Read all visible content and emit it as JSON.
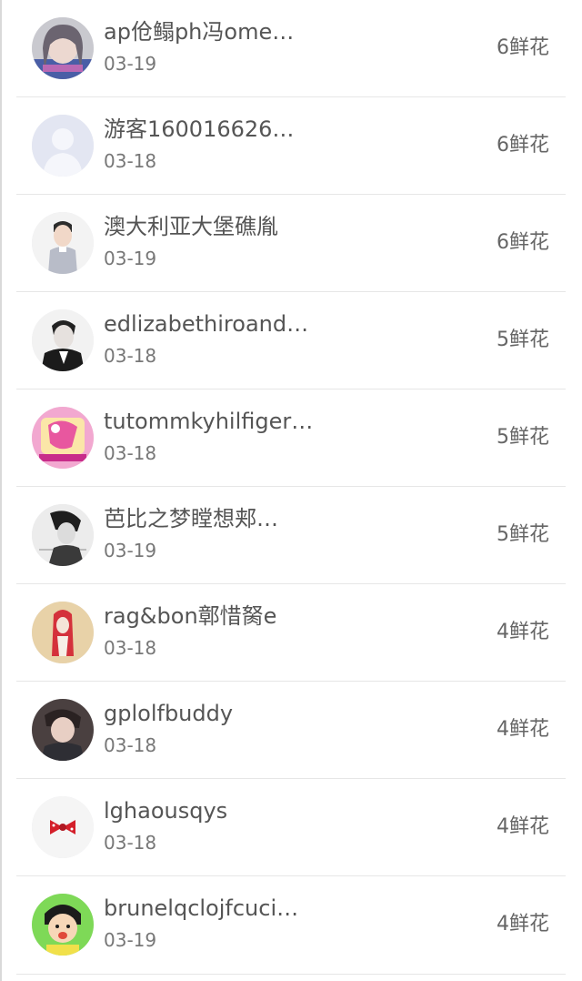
{
  "flower_ranking": {
    "rows": [
      {
        "name": "ap伧鳎ph冯ome…",
        "date": "03-19",
        "flowers": "6鲜花",
        "avatar_icon": "girl-photo-avatar-icon"
      },
      {
        "name": "游客160016626…",
        "date": "03-18",
        "flowers": "6鲜花",
        "avatar_icon": "default-user-avatar-icon"
      },
      {
        "name": "澳大利亚大堡礁胤",
        "date": "03-19",
        "flowers": "6鲜花",
        "avatar_icon": "boy-photo-avatar-icon"
      },
      {
        "name": "edlizabethiroand…",
        "date": "03-18",
        "flowers": "5鲜花",
        "avatar_icon": "man-bw-photo-avatar-icon"
      },
      {
        "name": "tutommkyhilfiger…",
        "date": "03-18",
        "flowers": "5鲜花",
        "avatar_icon": "pink-cartoon-avatar-icon"
      },
      {
        "name": "芭比之梦瞠想郏…",
        "date": "03-19",
        "flowers": "5鲜花",
        "avatar_icon": "sketch-portrait-avatar-icon"
      },
      {
        "name": "rag&bon鄣惜胬e",
        "date": "03-18",
        "flowers": "4鲜花",
        "avatar_icon": "red-hair-illustration-avatar-icon"
      },
      {
        "name": "gplolfbuddy",
        "date": "03-18",
        "flowers": "4鲜花",
        "avatar_icon": "young-man-photo-avatar-icon"
      },
      {
        "name": "lghaousqys",
        "date": "03-18",
        "flowers": "4鲜花",
        "avatar_icon": "red-bow-avatar-icon"
      },
      {
        "name": "brunelqclojfcuci…",
        "date": "03-19",
        "flowers": "4鲜花",
        "avatar_icon": "cartoon-girl-avatar-icon"
      }
    ]
  }
}
